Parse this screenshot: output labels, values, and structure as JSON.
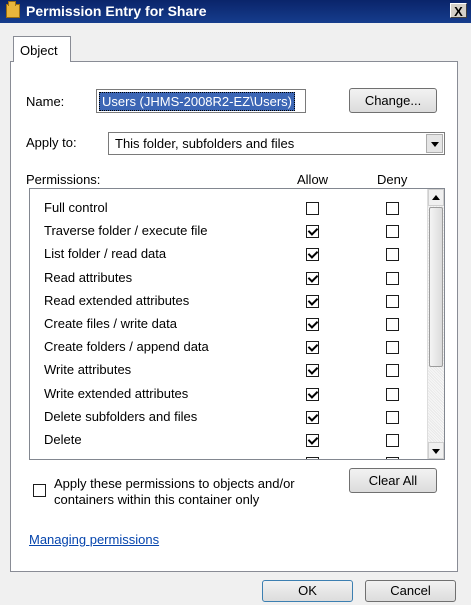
{
  "window": {
    "title": "Permission Entry for Share",
    "close_label": "X"
  },
  "tabs": [
    {
      "label": "Object"
    }
  ],
  "form": {
    "name_label": "Name:",
    "name_value": "Users (JHMS-2008R2-EZ\\Users)",
    "change_button": "Change...",
    "apply_to_label": "Apply to:",
    "apply_to_value": "This folder, subfolders and files"
  },
  "permissions": {
    "header_label": "Permissions:",
    "allow_header": "Allow",
    "deny_header": "Deny",
    "rows": [
      {
        "name": "Full control",
        "allow": false,
        "deny": false
      },
      {
        "name": "Traverse folder / execute file",
        "allow": true,
        "deny": false
      },
      {
        "name": "List folder / read data",
        "allow": true,
        "deny": false
      },
      {
        "name": "Read attributes",
        "allow": true,
        "deny": false
      },
      {
        "name": "Read extended attributes",
        "allow": true,
        "deny": false
      },
      {
        "name": "Create files / write data",
        "allow": true,
        "deny": false
      },
      {
        "name": "Create folders / append data",
        "allow": true,
        "deny": false
      },
      {
        "name": "Write attributes",
        "allow": true,
        "deny": false
      },
      {
        "name": "Write extended attributes",
        "allow": true,
        "deny": false
      },
      {
        "name": "Delete subfolders and files",
        "allow": true,
        "deny": false
      },
      {
        "name": "Delete",
        "allow": true,
        "deny": false
      },
      {
        "name": "",
        "allow": true,
        "deny": false
      }
    ]
  },
  "apply_checkbox": {
    "checked": false,
    "label": "Apply these permissions to objects and/or containers within this container only"
  },
  "clear_all_button": "Clear All",
  "managing_link": "Managing permissions",
  "footer": {
    "ok": "OK",
    "cancel": "Cancel"
  }
}
